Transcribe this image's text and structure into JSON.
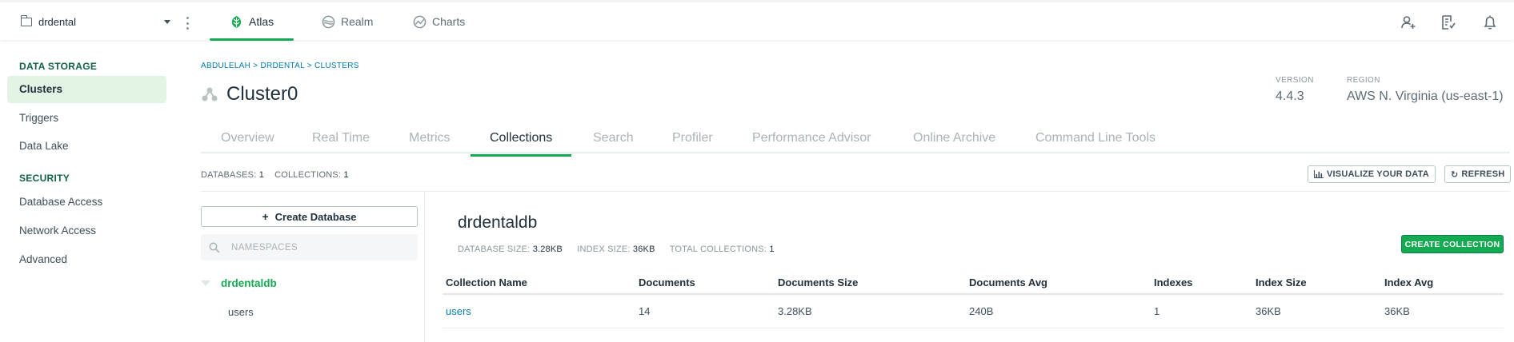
{
  "topbar": {
    "org_name": "drdental",
    "nav": [
      {
        "label": "Atlas",
        "icon": "atlas-leaf-icon",
        "active": true
      },
      {
        "label": "Realm",
        "icon": "realm-icon",
        "active": false
      },
      {
        "label": "Charts",
        "icon": "charts-icon",
        "active": false
      }
    ],
    "right_icons": [
      "invite-user-icon",
      "activity-feed-icon",
      "bell-icon"
    ],
    "accent": "#13aa52"
  },
  "sidebar": {
    "data_storage_heading": "DATA STORAGE",
    "data_storage_items": [
      "Clusters",
      "Triggers",
      "Data Lake"
    ],
    "security_heading": "SECURITY",
    "security_items": [
      "Database Access",
      "Network Access",
      "Advanced"
    ]
  },
  "header": {
    "breadcrumb": "ABDULELAH > DRDENTAL > CLUSTERS",
    "cluster_name": "Cluster0",
    "version_label": "VERSION",
    "version_value": "4.4.3",
    "region_label": "REGION",
    "region_value": "AWS N. Virginia (us-east-1)"
  },
  "tabs": [
    "Overview",
    "Real Time",
    "Metrics",
    "Collections",
    "Search",
    "Profiler",
    "Performance Advisor",
    "Online Archive",
    "Command Line Tools"
  ],
  "active_tab": "Collections",
  "summary": {
    "databases_label": "DATABASES:",
    "databases_value": "1",
    "collections_label": "COLLECTIONS:",
    "collections_value": "1",
    "visualize_label": "VISUALIZE YOUR DATA",
    "refresh_label": "REFRESH"
  },
  "namespaces": {
    "create_db_label": "Create Database",
    "search_placeholder": "NAMESPACES",
    "database": "drdentaldb",
    "collections": [
      "users"
    ]
  },
  "database_detail": {
    "name": "drdentaldb",
    "db_size_label": "DATABASE SIZE:",
    "db_size_value": "3.28KB",
    "index_size_label": "INDEX SIZE:",
    "index_size_value": "36KB",
    "total_collections_label": "TOTAL COLLECTIONS:",
    "total_collections_value": "1",
    "create_collection_label": "CREATE COLLECTION"
  },
  "table": {
    "headers": [
      "Collection Name",
      "Documents",
      "Documents Size",
      "Documents Avg",
      "Indexes",
      "Index Size",
      "Index Avg"
    ],
    "rows": [
      [
        "users",
        "14",
        "3.28KB",
        "240B",
        "1",
        "36KB",
        "36KB"
      ]
    ]
  }
}
